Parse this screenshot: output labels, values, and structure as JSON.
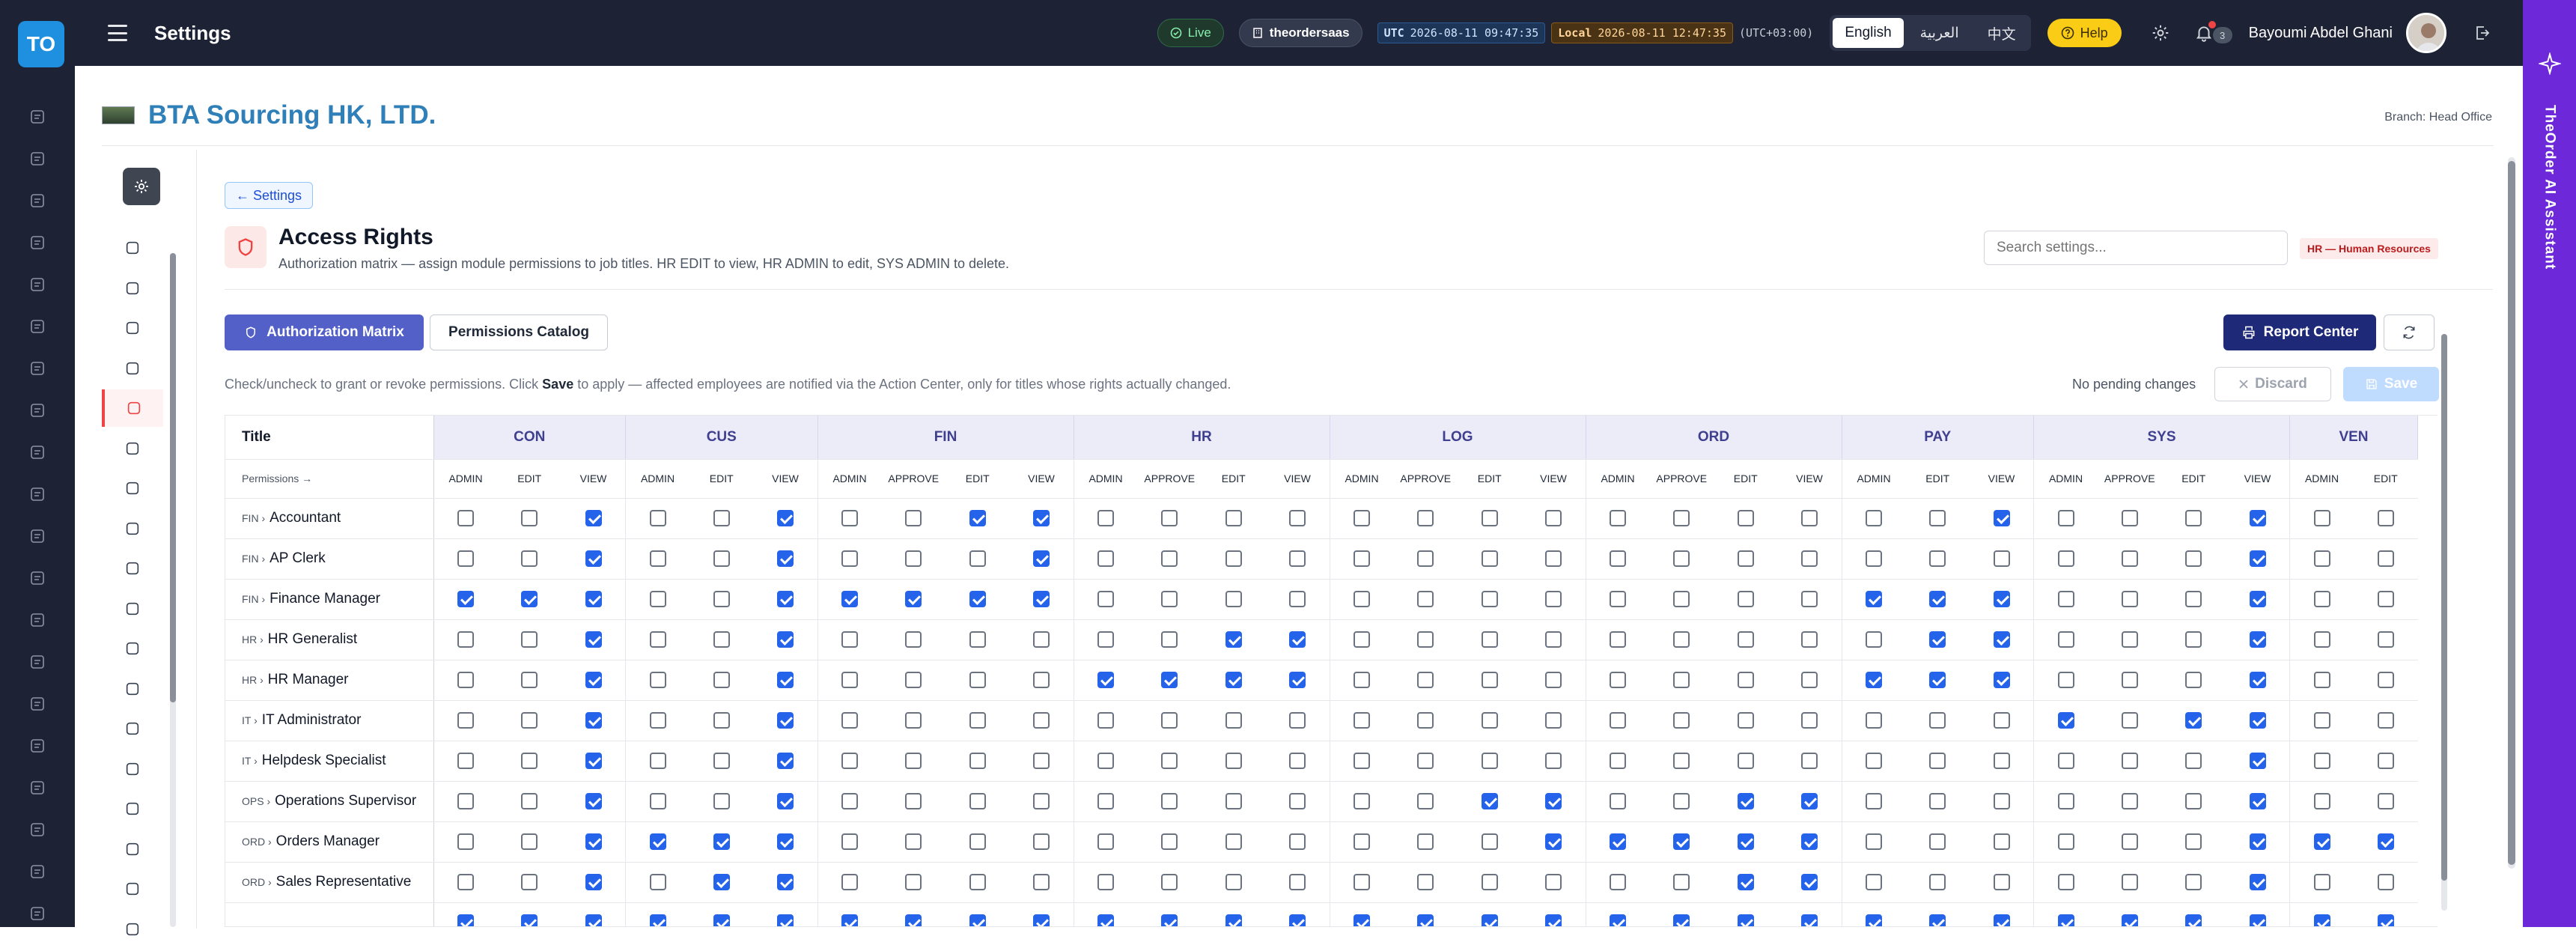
{
  "app": {
    "logo": "TO",
    "title": "Settings"
  },
  "topbar": {
    "live": "Live",
    "tenant": "theordersaas",
    "utc_label": "UTC",
    "utc_time": "2026-08-11 09:47:35",
    "local_label": "Local",
    "local_time": "2026-08-11 12:47:35",
    "tz": "(UTC+03:00)",
    "languages": [
      "English",
      "العربية",
      "中文"
    ],
    "help": "Help",
    "notif_count": "3",
    "user": "Bayoumi Abdel Ghani"
  },
  "company": {
    "name": "BTA Sourcing HK, LTD.",
    "branch": "Branch: Head Office"
  },
  "page": {
    "back": "← Settings",
    "title": "Access Rights",
    "subtitle": "Authorization matrix — assign module permissions to job titles. HR EDIT to view, HR ADMIN to edit, SYS ADMIN to delete.",
    "search_placeholder": "Search settings...",
    "module_badge": "HR — Human Resources",
    "tab_active": "Authorization Matrix",
    "tab_other": "Permissions Catalog",
    "report": "Report Center",
    "help_pre": "Check/uncheck to grant or revoke permissions. Click ",
    "help_bold": "Save",
    "help_post": " to apply — affected employees are notified via the Action Center, only for titles whose rights actually changed.",
    "pending": "No pending changes",
    "discard": "Discard",
    "save": "Save"
  },
  "ai_assistant": "TheOrder AI Assistant",
  "matrix": {
    "title_header": "Title",
    "perm_header": "Permissions →",
    "groups": [
      {
        "name": "CON",
        "cols": [
          "ADMIN",
          "EDIT",
          "VIEW"
        ]
      },
      {
        "name": "CUS",
        "cols": [
          "ADMIN",
          "EDIT",
          "VIEW"
        ]
      },
      {
        "name": "FIN",
        "cols": [
          "ADMIN",
          "APPROVE",
          "EDIT",
          "VIEW"
        ]
      },
      {
        "name": "HR",
        "cols": [
          "ADMIN",
          "APPROVE",
          "EDIT",
          "VIEW"
        ]
      },
      {
        "name": "LOG",
        "cols": [
          "ADMIN",
          "APPROVE",
          "EDIT",
          "VIEW"
        ]
      },
      {
        "name": "ORD",
        "cols": [
          "ADMIN",
          "APPROVE",
          "EDIT",
          "VIEW"
        ]
      },
      {
        "name": "PAY",
        "cols": [
          "ADMIN",
          "EDIT",
          "VIEW"
        ]
      },
      {
        "name": "SYS",
        "cols": [
          "ADMIN",
          "APPROVE",
          "EDIT",
          "VIEW"
        ]
      },
      {
        "name": "VEN",
        "cols": [
          "ADMIN",
          "EDIT"
        ]
      }
    ],
    "rows": [
      {
        "prefix": "FIN ›",
        "title": "Accountant",
        "checks": [
          0,
          0,
          1,
          0,
          0,
          1,
          0,
          0,
          1,
          1,
          0,
          0,
          0,
          0,
          0,
          0,
          0,
          0,
          0,
          0,
          0,
          0,
          0,
          0,
          1,
          0,
          0,
          0,
          1,
          0,
          0
        ]
      },
      {
        "prefix": "FIN ›",
        "title": "AP Clerk",
        "checks": [
          0,
          0,
          1,
          0,
          0,
          1,
          0,
          0,
          0,
          1,
          0,
          0,
          0,
          0,
          0,
          0,
          0,
          0,
          0,
          0,
          0,
          0,
          0,
          0,
          0,
          0,
          0,
          0,
          1,
          0,
          0
        ]
      },
      {
        "prefix": "FIN ›",
        "title": "Finance Manager",
        "checks": [
          1,
          1,
          1,
          0,
          0,
          1,
          1,
          1,
          1,
          1,
          0,
          0,
          0,
          0,
          0,
          0,
          0,
          0,
          0,
          0,
          0,
          0,
          1,
          1,
          1,
          0,
          0,
          0,
          1,
          0,
          0
        ]
      },
      {
        "prefix": "HR ›",
        "title": "HR Generalist",
        "checks": [
          0,
          0,
          1,
          0,
          0,
          1,
          0,
          0,
          0,
          0,
          0,
          0,
          1,
          1,
          0,
          0,
          0,
          0,
          0,
          0,
          0,
          0,
          0,
          1,
          1,
          0,
          0,
          0,
          1,
          0,
          0
        ]
      },
      {
        "prefix": "HR ›",
        "title": "HR Manager",
        "checks": [
          0,
          0,
          1,
          0,
          0,
          1,
          0,
          0,
          0,
          0,
          1,
          1,
          1,
          1,
          0,
          0,
          0,
          0,
          0,
          0,
          0,
          0,
          1,
          1,
          1,
          0,
          0,
          0,
          1,
          0,
          0
        ]
      },
      {
        "prefix": "IT ›",
        "title": "IT Administrator",
        "checks": [
          0,
          0,
          1,
          0,
          0,
          1,
          0,
          0,
          0,
          0,
          0,
          0,
          0,
          0,
          0,
          0,
          0,
          0,
          0,
          0,
          0,
          0,
          0,
          0,
          0,
          1,
          0,
          1,
          1,
          0,
          0
        ]
      },
      {
        "prefix": "IT ›",
        "title": "Helpdesk Specialist",
        "checks": [
          0,
          0,
          1,
          0,
          0,
          1,
          0,
          0,
          0,
          0,
          0,
          0,
          0,
          0,
          0,
          0,
          0,
          0,
          0,
          0,
          0,
          0,
          0,
          0,
          0,
          0,
          0,
          0,
          1,
          0,
          0
        ]
      },
      {
        "prefix": "OPS ›",
        "title": "Operations Supervisor",
        "checks": [
          0,
          0,
          1,
          0,
          0,
          1,
          0,
          0,
          0,
          0,
          0,
          0,
          0,
          0,
          0,
          0,
          1,
          1,
          0,
          0,
          1,
          1,
          0,
          0,
          0,
          0,
          0,
          0,
          1,
          0,
          0
        ]
      },
      {
        "prefix": "ORD ›",
        "title": "Orders Manager",
        "checks": [
          0,
          0,
          1,
          1,
          1,
          1,
          0,
          0,
          0,
          0,
          0,
          0,
          0,
          0,
          0,
          0,
          0,
          1,
          1,
          1,
          1,
          1,
          0,
          0,
          0,
          0,
          0,
          0,
          1,
          1,
          1
        ]
      },
      {
        "prefix": "ORD ›",
        "title": "Sales Representative",
        "checks": [
          0,
          0,
          1,
          0,
          1,
          1,
          0,
          0,
          0,
          0,
          0,
          0,
          0,
          0,
          0,
          0,
          0,
          0,
          0,
          0,
          1,
          1,
          0,
          0,
          0,
          0,
          0,
          0,
          1,
          0,
          0
        ]
      },
      {
        "prefix": "",
        "title": "",
        "checks": [
          1,
          1,
          1,
          1,
          1,
          1,
          1,
          1,
          1,
          1,
          1,
          1,
          1,
          1,
          1,
          1,
          1,
          1,
          1,
          1,
          1,
          1,
          1,
          1,
          1,
          1,
          1,
          1,
          1,
          1,
          1
        ]
      }
    ]
  },
  "colors": {
    "topbar": "#1e2235",
    "accent": "#5360c8",
    "ai": "#6d28d9",
    "check": "#2563eb"
  }
}
